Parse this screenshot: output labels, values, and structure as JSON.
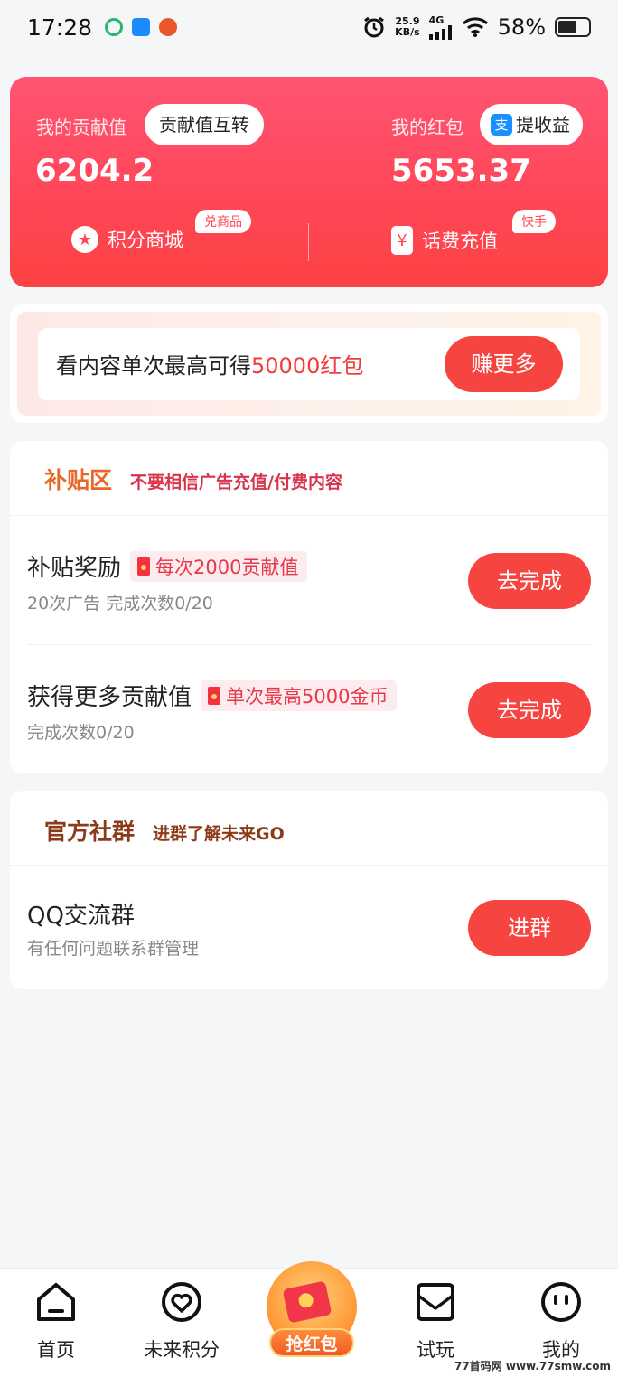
{
  "status_bar": {
    "time": "17:28",
    "net_speed": "25.9",
    "net_unit": "KB/s",
    "signal": "4G",
    "battery": "58%"
  },
  "hero": {
    "contribution_label": "我的贡献值",
    "contribution_swap": "贡献值互转",
    "contribution_value": "6204.2",
    "redpacket_label": "我的红包",
    "withdraw_label": "提收益",
    "redpacket_value": "5653.37",
    "mall_label": "积分商城",
    "mall_tag": "兑商品",
    "recharge_label": "话费充值",
    "recharge_tag": "快手"
  },
  "banner": {
    "text_prefix": "看内容单次最高可得",
    "text_highlight": "50000红包",
    "button": "赚更多"
  },
  "subsidy": {
    "title": "补贴区",
    "subtitle": "不要相信广告充值/付费内容",
    "items": [
      {
        "title": "补贴奖励",
        "badge": "每次2000贡献值",
        "desc": "20次广告  完成次数0/20",
        "button": "去完成"
      },
      {
        "title": "获得更多贡献值",
        "badge": "单次最高5000金币",
        "desc": "完成次数0/20",
        "button": "去完成"
      }
    ]
  },
  "group": {
    "title": "官方社群",
    "subtitle": "进群了解未来GO",
    "item_title": "QQ交流群",
    "item_desc": "有任何问题联系群管理",
    "button": "进群"
  },
  "tabbar": {
    "home": "首页",
    "points": "未来积分",
    "center": "抢红包",
    "trial": "试玩",
    "mine": "我的"
  },
  "watermark": "77首码网 www.77smw.com",
  "colors": {
    "accent": "#f64540",
    "hero_top": "#ff5474",
    "subsidy_title": "#e8682a",
    "subsidy_sub": "#d8344c",
    "group_title": "#8b3a1a"
  }
}
